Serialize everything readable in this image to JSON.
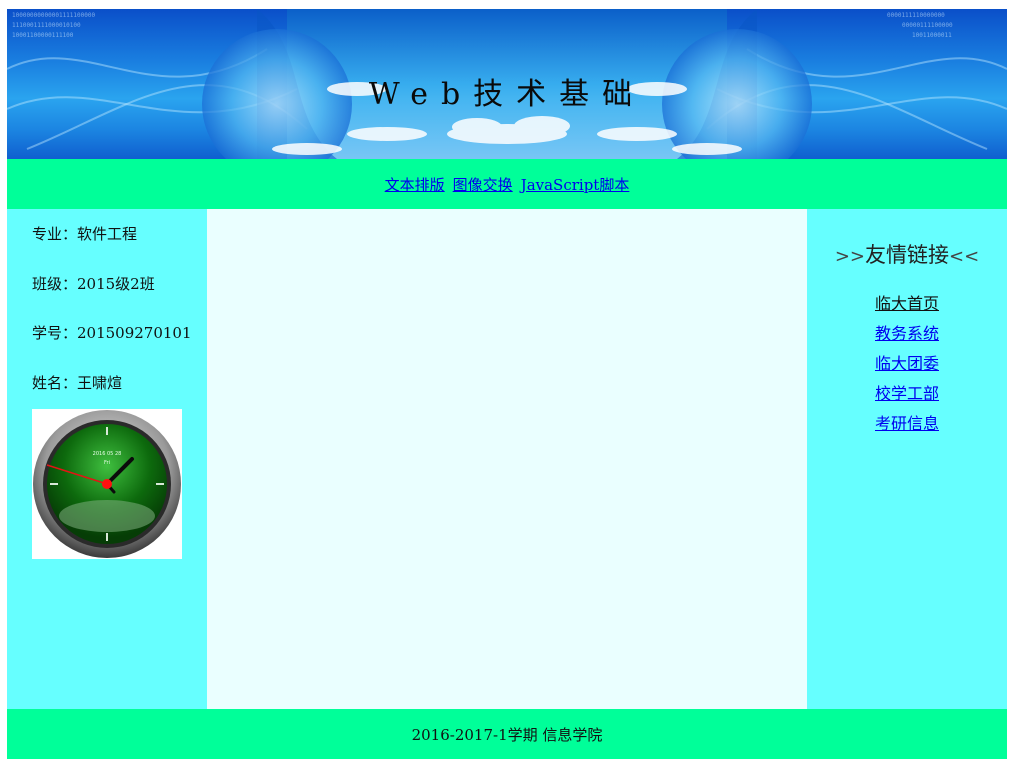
{
  "banner": {
    "title": "Web技术基础"
  },
  "nav": {
    "items": [
      "文本排版",
      "图像交换",
      "JavaScript脚本"
    ]
  },
  "student": {
    "major": "专业：软件工程",
    "class": "班级：2015级2班",
    "id": "学号：201509270101",
    "name": "姓名：王啸煊"
  },
  "clock": {
    "face_text_1": "2016 05 28",
    "face_text_2": "Fri"
  },
  "links": {
    "title_prefix": ">>",
    "title": "友情链接",
    "title_suffix": "<<",
    "items": [
      "临大首页",
      "教务系统",
      "临大团委",
      "校学工部",
      "考研信息"
    ]
  },
  "footer": {
    "text": "2016-2017-1学期 信息学院"
  },
  "colors": {
    "nav_bg": "#00ff99",
    "side_bg": "#66ffff",
    "content_bg": "#eaffff",
    "link": "#0000ee"
  }
}
